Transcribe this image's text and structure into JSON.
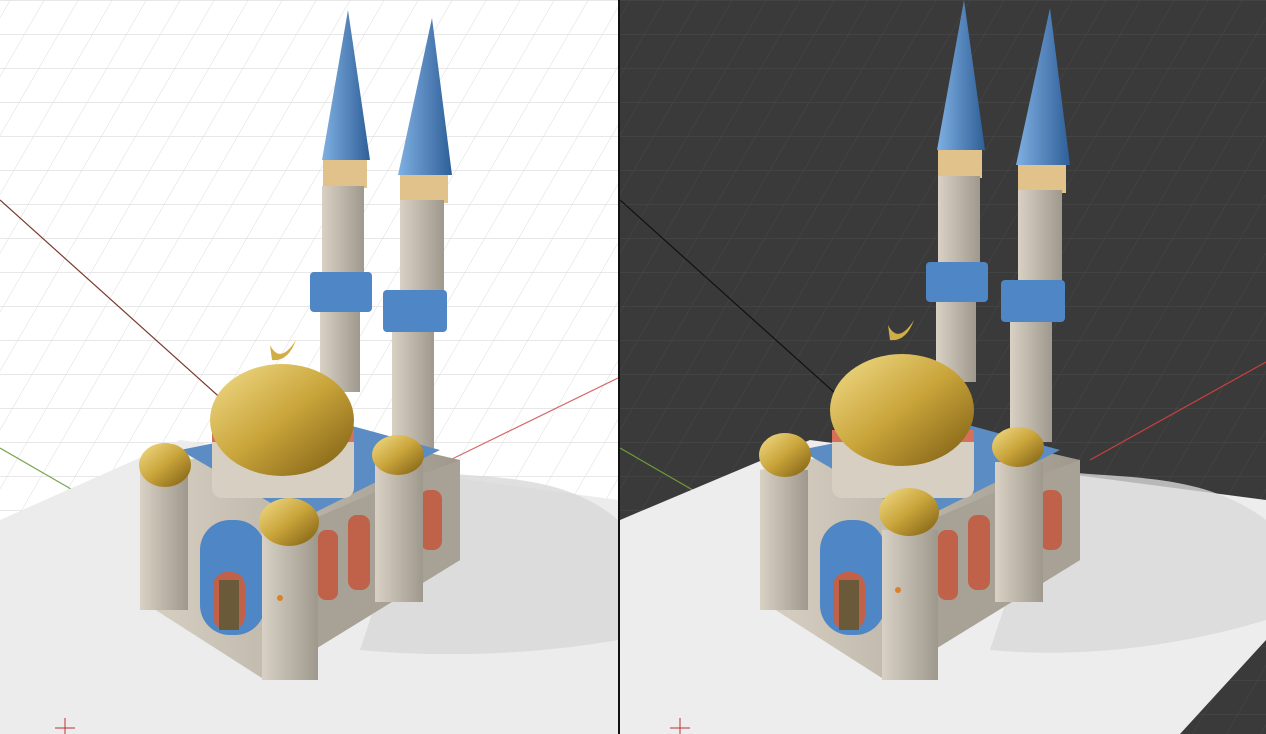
{
  "scene": {
    "object": "mosque-model",
    "views": [
      {
        "id": "light",
        "theme": "light-grid"
      },
      {
        "id": "dark",
        "theme": "dark-grid"
      }
    ]
  },
  "colors": {
    "light_bg": "#ffffff",
    "light_grid": "#d4d4d4",
    "dark_bg": "#3b3b3b",
    "dark_grid": "#505050",
    "ground": "#ededed",
    "axis_x": "#c9403f",
    "axis_y": "#6f9b3a",
    "stone": "#c8c0b2",
    "stone_dark": "#8e887e",
    "roof_blue": "#5b8cc4",
    "tile_blue": "#4f86c6",
    "gold": "#c9a43a",
    "gold_dark": "#8c6d1c",
    "brick": "#c0614a"
  },
  "icons": [
    "origin-cursor-icon",
    "crescent-icon"
  ]
}
